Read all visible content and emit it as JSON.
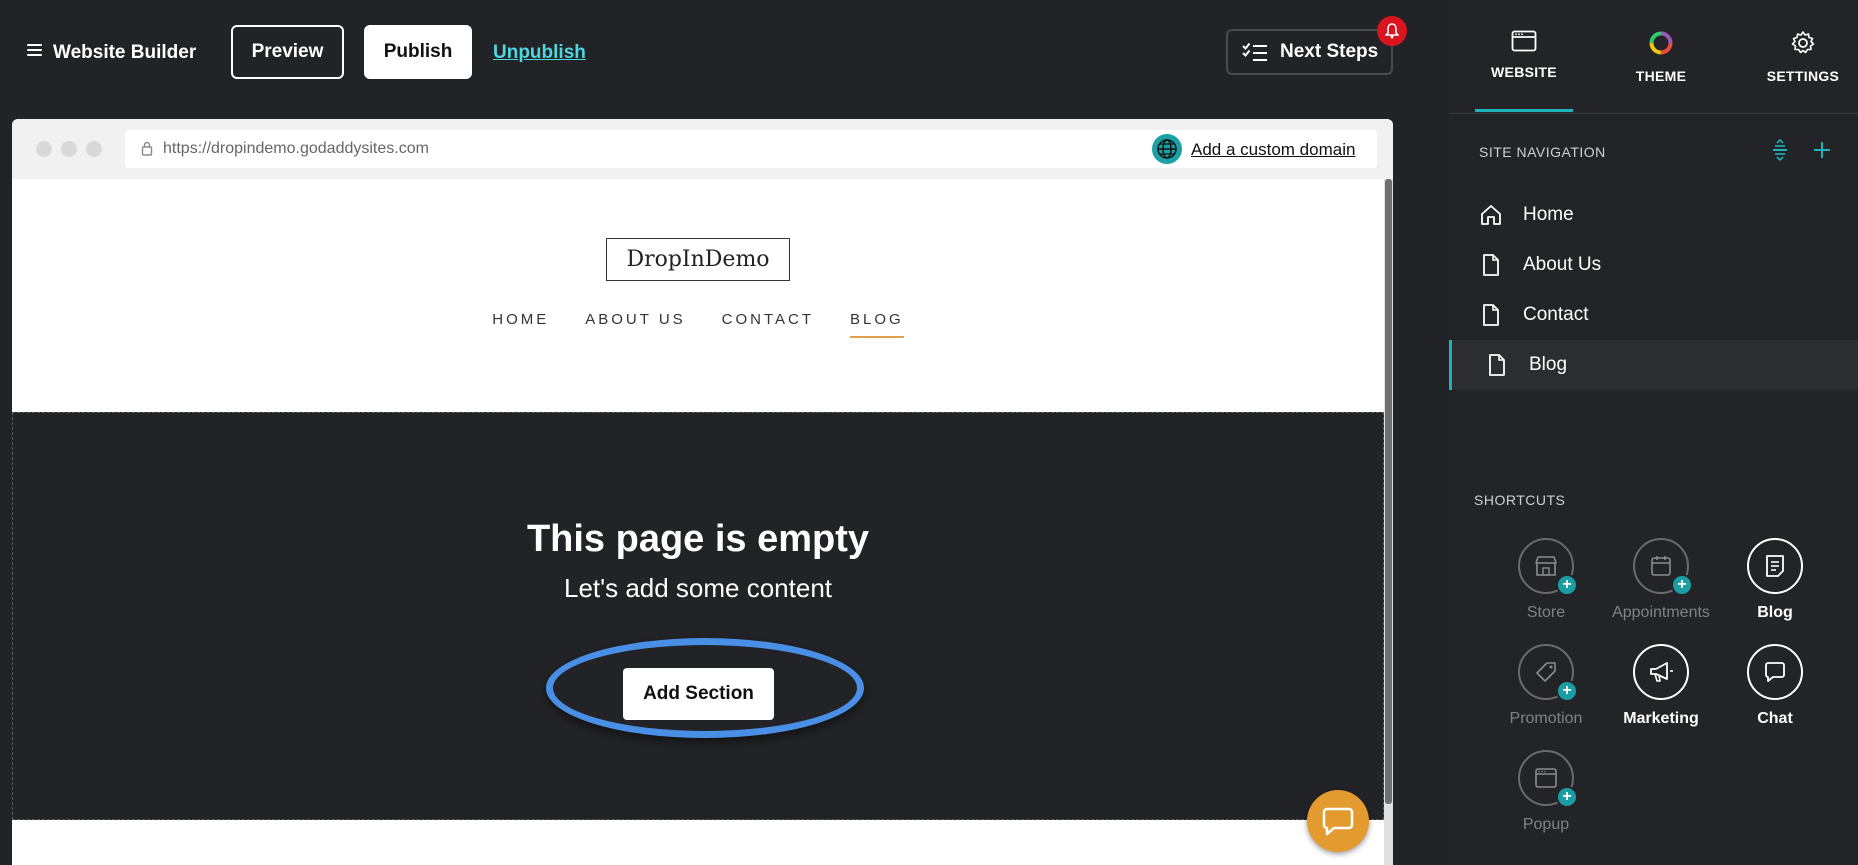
{
  "topbar": {
    "app_title": "Website Builder",
    "preview_label": "Preview",
    "publish_label": "Publish",
    "unpublish_label": "Unpublish",
    "next_steps_label": "Next Steps"
  },
  "browser": {
    "url": "https://dropindemo.godaddysites.com",
    "custom_domain_label": "Add a custom domain"
  },
  "site": {
    "logo": "DropInDemo",
    "nav": [
      "HOME",
      "ABOUT US",
      "CONTACT",
      "BLOG"
    ],
    "active_nav": "BLOG"
  },
  "empty_state": {
    "title": "This page is empty",
    "subtitle": "Let's add some content",
    "add_section_label": "Add Section"
  },
  "panel": {
    "tabs": [
      {
        "label": "WEBSITE",
        "icon": "browser-window-icon",
        "active": true
      },
      {
        "label": "THEME",
        "icon": "color-wheel-icon",
        "active": false
      },
      {
        "label": "SETTINGS",
        "icon": "gear-icon",
        "active": false
      }
    ],
    "site_navigation_heading": "SITE NAVIGATION",
    "pages": [
      {
        "label": "Home",
        "icon": "home-icon",
        "active": false
      },
      {
        "label": "About Us",
        "icon": "page-icon",
        "active": false
      },
      {
        "label": "Contact",
        "icon": "page-icon",
        "active": false
      },
      {
        "label": "Blog",
        "icon": "page-icon",
        "active": true
      }
    ],
    "shortcuts_heading": "SHORTCUTS",
    "shortcuts": [
      {
        "label": "Store",
        "icon": "store-icon",
        "enabled": false
      },
      {
        "label": "Appointments",
        "icon": "calendar-icon",
        "enabled": false
      },
      {
        "label": "Blog",
        "icon": "blog-icon",
        "enabled": true
      },
      {
        "label": "Promotion",
        "icon": "tag-icon",
        "enabled": false
      },
      {
        "label": "Marketing",
        "icon": "megaphone-icon",
        "enabled": true
      },
      {
        "label": "Chat",
        "icon": "chat-bubble-icon",
        "enabled": true
      },
      {
        "label": "Popup",
        "icon": "popup-window-icon",
        "enabled": false
      }
    ]
  },
  "colors": {
    "accent": "#1eb3b8",
    "link": "#4fd6e0",
    "highlight_ellipse": "#4a8fe6",
    "chat_fab": "#e39a2e",
    "notification": "#d8141c"
  }
}
